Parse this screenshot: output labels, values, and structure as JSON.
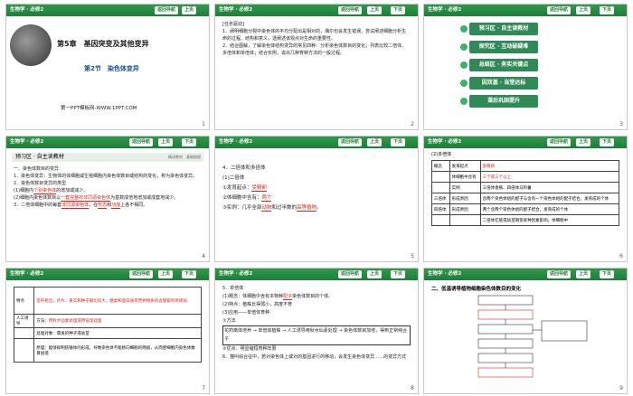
{
  "header": {
    "brand": "生物学 · 必修2",
    "nav_label": "返回导航",
    "prev_label": "上页",
    "next_label": "下页"
  },
  "slides": [
    {
      "num": "1",
      "chapter": "第5章　基因突变及其他变异",
      "section": "第2节　染色体变异",
      "footer": "第一PPT模板网-WWW.1PPT.COM"
    },
    {
      "num": "2",
      "title": "[任务驱动]",
      "lines": [
        "1．阐明细胞分裂中染色体的平均分配出是相对的，偶尔也会发生错误。尝试阐述细胞分析生命的过程、结构和意义，透阐述该观点对生命的重要性。",
        "2．结合图解，了解染色体结构变异的常见四种：分析染色体数目的变化；列表比较二倍体、多倍体和单倍体；结合实例，说出几种育种方法的一般过程。"
      ]
    },
    {
      "num": "3",
      "menu": [
        "预习区 · 自主读教材",
        "探究区 · 互动破疑难",
        "总结区 · 务实关键点",
        "因双基 · 当堂达标",
        "课后巩固提升"
      ]
    },
    {
      "num": "4",
      "section_title": "预习区 · 自主读教材",
      "sub1": "精读教材　基础梳理",
      "lines": [
        "一、染色体数目的变异",
        "1．染色体变异：生物体的体细胞或生殖细胞内染色体数目或结构的变化，称为染色体变异。",
        "2．染色体数目变异的类型",
        "(1)细胞内",
        "的增加或减少。",
        "(2)细胞内染色体数目以",
        "为基数成倍地增加或成套地减少。",
        "3．二倍体细胞中的每套",
        "，在",
        "和",
        "上各不相同。"
      ],
      "fill1": "个别染色体",
      "fill2": "一套完整的非同源染色体",
      "fill3": "非同源染色体",
      "fill4": "形态",
      "fill5": "功能"
    },
    {
      "num": "5",
      "lines": [
        "4．二倍体和多倍体",
        "(1)二倍体",
        "①发育起点：",
        "②体细胞中含有：",
        "③实例：几乎全部",
        "和过半数的",
        "。"
      ],
      "fill1": "受精卵",
      "fill2": "两个",
      "fill3": "动物",
      "fill4": "高等植物"
    },
    {
      "num": "6",
      "title": "(2)多倍体",
      "rows": [
        [
          "概念",
          "发育起点",
          "受精卵"
        ],
        [
          "",
          "体细胞中含有",
          "三个或三个以上"
        ],
        [
          "",
          "实例",
          "三倍体香蕉、四倍体马铃薯"
        ],
        [
          "三倍体",
          "形成原因",
          "含两个染色体组的配子与含有一个染色体组的配子结合，发育成的个体"
        ],
        [
          "四倍体",
          "形成原因",
          "两个含两个染色体组的配子结合，发育成的个体"
        ],
        [
          "",
          "",
          "二倍体在胚或幼苗期受某种因素影响，体细胞中"
        ]
      ]
    },
    {
      "num": "7",
      "rows": [
        [
          "特点",
          "茎秆粗壮，叶片、果实和种子都比较大，糖类和蛋白质等营养物质的含量都有所增加"
        ],
        [
          "人工诱导",
          "方法",
          "用秋水仙素处理或用低温处理"
        ],
        [
          "",
          "处理对象",
          "萌发的种子或幼苗"
        ],
        [
          "",
          "原理",
          "能够抑制纺锤体的形成，导致染色体不能移向细胞的两极，从而使细胞内染色体数目加倍"
        ]
      ]
    },
    {
      "num": "8",
      "lines": [
        "5．单倍体",
        "(1)概念：体细胞中含有本物种",
        "染色体数目的个体。",
        "(2)特点：植株长得弱小，高度不育",
        "(3)应用——单倍体育种",
        "①方法",
        "花药离体培养 → 单倍体植株 → 人工诱导用秋水仙素处理 → 染色体数目加倍，得到正常纯合子",
        "②优点：明显缩短育种年限",
        "6．猫叫综合征中，若对染色体上或对的基因进行的移动，会发生染色体变异……的变异方式"
      ],
      "fill1": "配子"
    },
    {
      "num": "9",
      "title": "二、低温诱导植物细胞染色体数目的变化"
    }
  ]
}
